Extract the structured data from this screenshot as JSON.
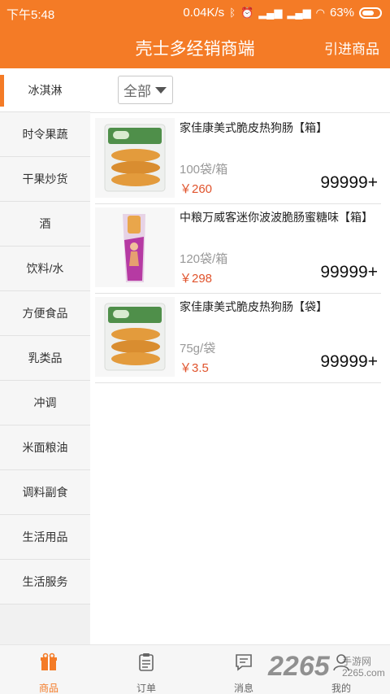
{
  "statusbar": {
    "time": "下午5:48",
    "net_speed": "0.04K/s",
    "battery_pct": "63%"
  },
  "header": {
    "title": "壳士多经销商端",
    "action": "引进商品"
  },
  "sidebar": {
    "active_index": 0,
    "items": [
      {
        "label": "冰淇淋"
      },
      {
        "label": "时令果蔬"
      },
      {
        "label": "干果炒货"
      },
      {
        "label": "酒"
      },
      {
        "label": "饮料/水"
      },
      {
        "label": "方便食品"
      },
      {
        "label": "乳类品"
      },
      {
        "label": "冲调"
      },
      {
        "label": "米面粮油"
      },
      {
        "label": "调料副食"
      },
      {
        "label": "生活用品"
      },
      {
        "label": "生活服务"
      }
    ]
  },
  "filter": {
    "selected": "全部"
  },
  "products": [
    {
      "name": "家佳康美式脆皮热狗肠【箱】",
      "unit": "100袋/箱",
      "price": "￥260",
      "stock": "99999+"
    },
    {
      "name": "中粮万威客迷你波波脆肠蜜糖味【箱】",
      "unit": "120袋/箱",
      "price": "￥298",
      "stock": "99999+"
    },
    {
      "name": "家佳康美式脆皮热狗肠【袋】",
      "unit": "75g/袋",
      "price": "￥3.5",
      "stock": "99999+"
    }
  ],
  "bottomnav": {
    "items": [
      {
        "label": "商品",
        "icon": "gift-icon"
      },
      {
        "label": "订单",
        "icon": "clipboard-icon"
      },
      {
        "label": "消息",
        "icon": "message-icon"
      },
      {
        "label": "我的",
        "icon": "user-icon"
      }
    ]
  },
  "watermark": {
    "brand": "2265",
    "site_cn": "手游网",
    "site_url": "2265.com"
  },
  "colors": {
    "accent": "#f47b26",
    "price": "#e0532c"
  }
}
